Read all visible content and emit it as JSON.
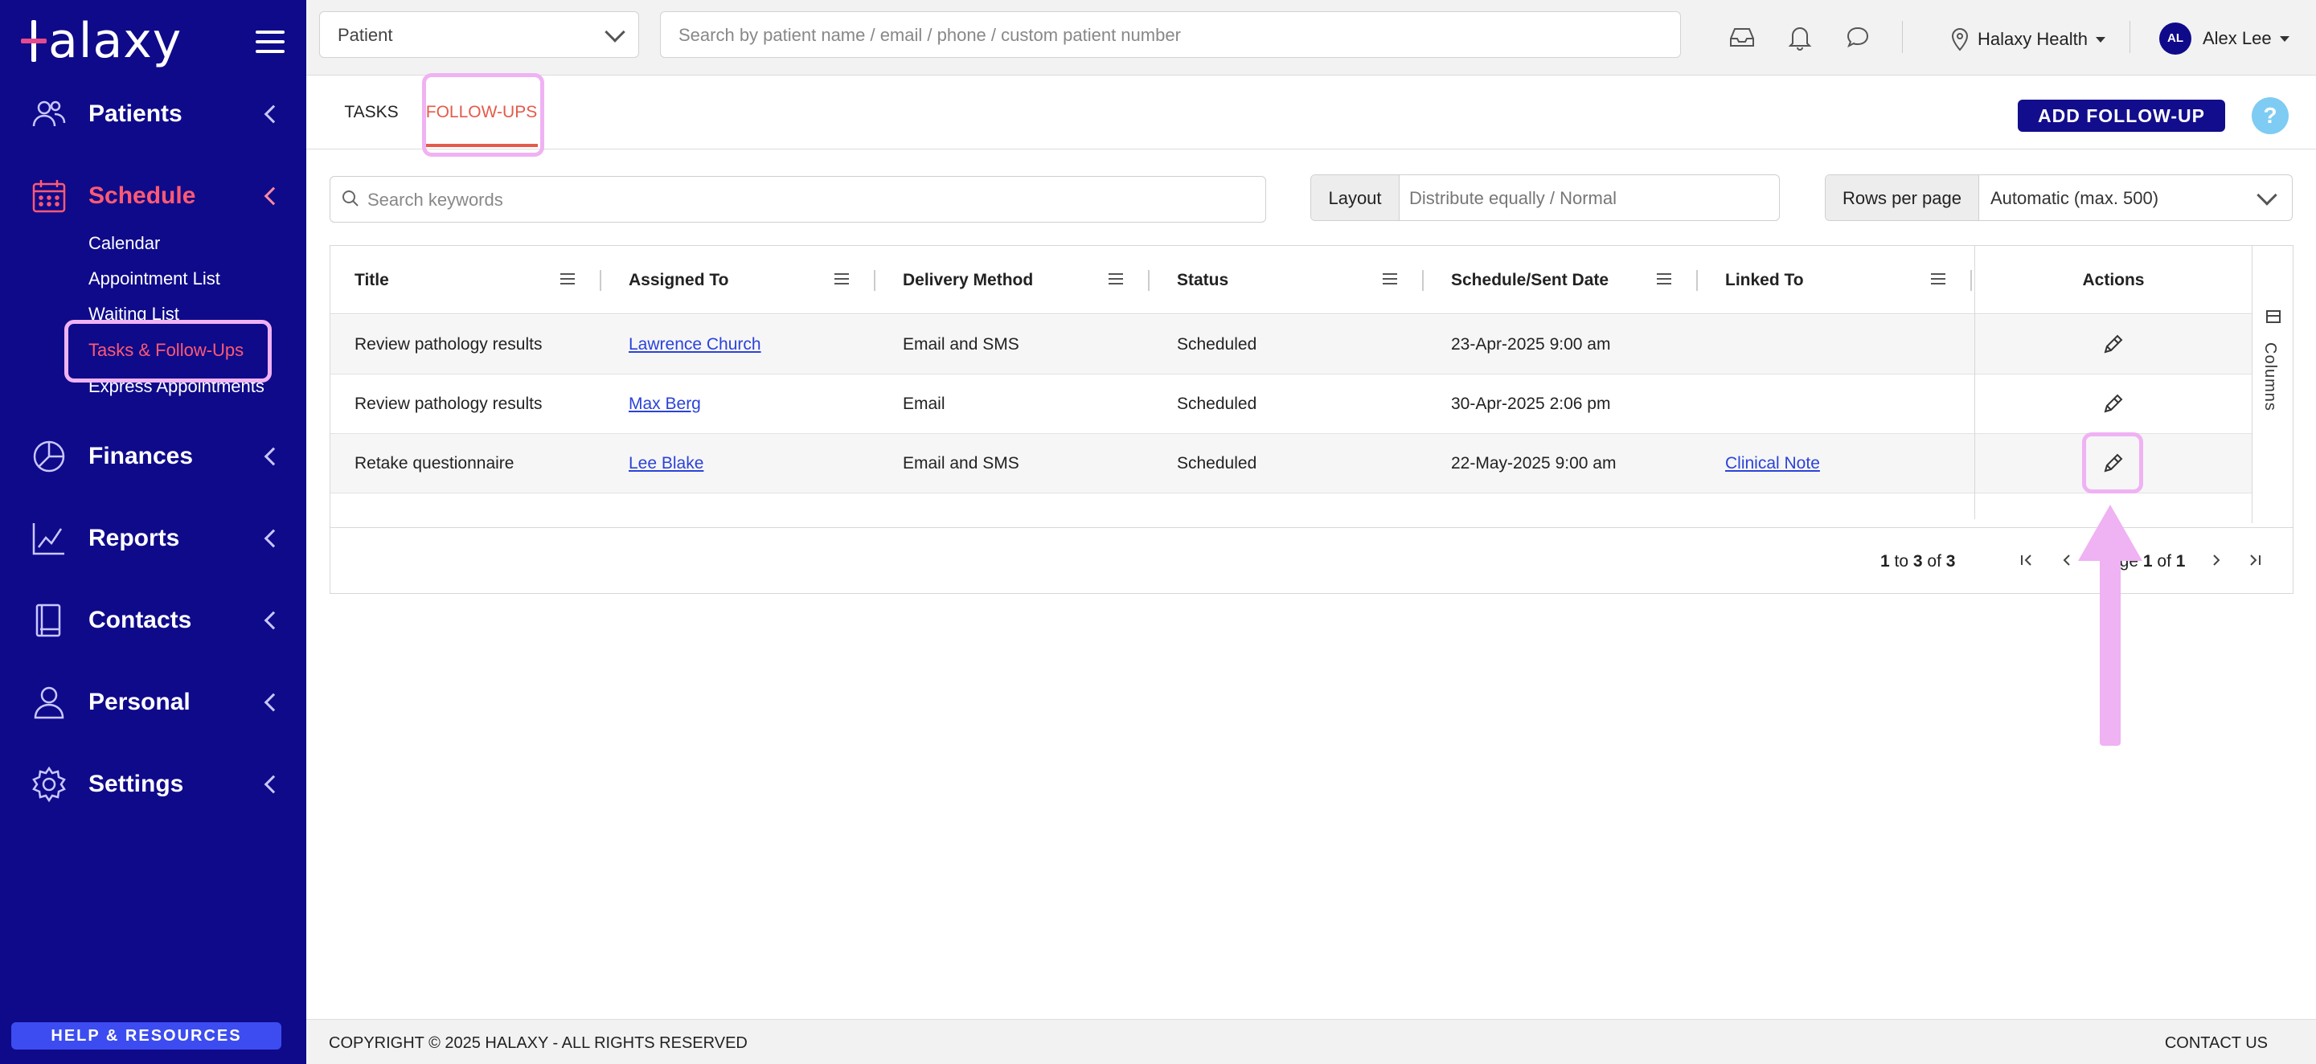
{
  "brand": {
    "name": "Halaxy",
    "logo_text": "alaxy",
    "accent": "#e44a8c",
    "sidebar_bg": "#0f0a8a"
  },
  "sidebar": {
    "items": [
      {
        "label": "Patients",
        "icon": "people-icon"
      },
      {
        "label": "Schedule",
        "icon": "calendar-icon",
        "active": true
      },
      {
        "label": "Finances",
        "icon": "pie-chart-icon"
      },
      {
        "label": "Reports",
        "icon": "line-chart-icon"
      },
      {
        "label": "Contacts",
        "icon": "address-book-icon"
      },
      {
        "label": "Personal",
        "icon": "person-icon"
      },
      {
        "label": "Settings",
        "icon": "gear-icon"
      }
    ],
    "schedule_sub": [
      "Calendar",
      "Appointment List",
      "Waiting List",
      "Tasks & Follow-Ups",
      "Express Appointments"
    ],
    "help_label": "HELP & RESOURCES"
  },
  "topbar": {
    "patient_select": "Patient",
    "search_placeholder": "Search by patient name / email / phone / custom patient number",
    "org": "Halaxy Health",
    "user_initials": "AL",
    "user_name": "Alex Lee"
  },
  "tabs": [
    {
      "label": "TASKS"
    },
    {
      "label": "FOLLOW-UPS",
      "active": true
    }
  ],
  "add_button": "ADD FOLLOW-UP",
  "help_glyph": "?",
  "filters": {
    "keyword_placeholder": "Search keywords",
    "layout_label": "Layout",
    "layout_value": "Distribute equally / Normal",
    "rows_label": "Rows per page",
    "rows_value": "Automatic (max. 500)"
  },
  "table": {
    "columns": [
      "Title",
      "Assigned To",
      "Delivery Method",
      "Status",
      "Schedule/Sent Date",
      "Linked To",
      "Actions"
    ],
    "rows": [
      {
        "title": "Review pathology results",
        "assigned": "Lawrence Church",
        "delivery": "Email and SMS",
        "status": "Scheduled",
        "date": "23-Apr-2025 9:00 am",
        "linked": ""
      },
      {
        "title": "Review pathology results",
        "assigned": "Max Berg",
        "delivery": "Email",
        "status": "Scheduled",
        "date": "30-Apr-2025 2:06 pm",
        "linked": ""
      },
      {
        "title": "Retake questionnaire",
        "assigned": "Lee Blake",
        "delivery": "Email and SMS",
        "status": "Scheduled",
        "date": "22-May-2025 9:00 am",
        "linked": "Clinical Note"
      }
    ],
    "columns_panel_label": "Columns"
  },
  "pagination": {
    "from": "1",
    "to_word": "to",
    "to": "3",
    "of_word": "of",
    "total": "3",
    "page_word": "Page",
    "page": "1",
    "pages": "1"
  },
  "footer": {
    "copyright": "COPYRIGHT © 2025 HALAXY - ALL RIGHTS RESERVED",
    "contact": "CONTACT US"
  }
}
